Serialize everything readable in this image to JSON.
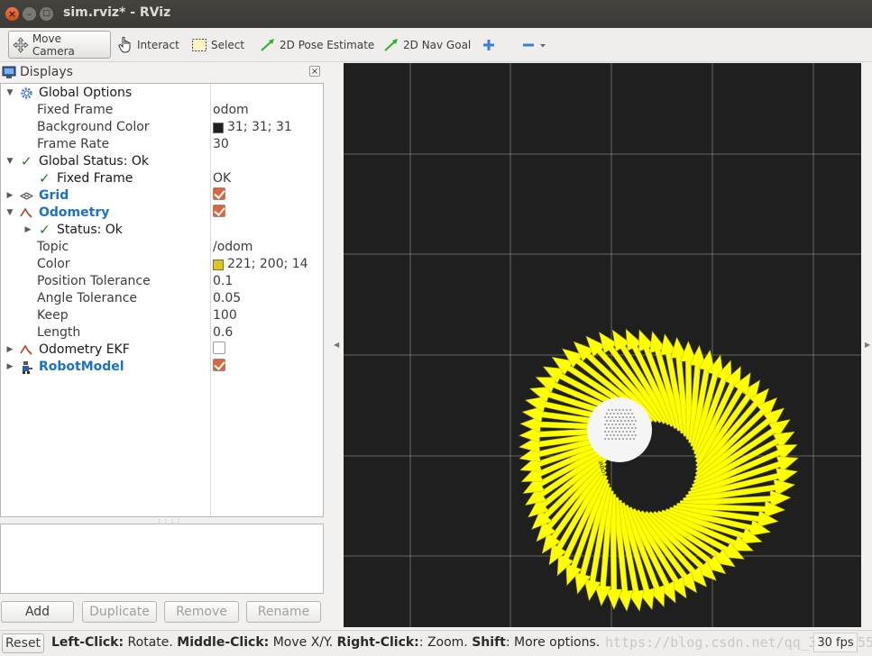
{
  "window": {
    "title": "sim.rviz* - RViz"
  },
  "toolbar": {
    "move_camera": "Move Camera",
    "interact": "Interact",
    "select": "Select",
    "pose_estimate": "2D Pose Estimate",
    "nav_goal": "2D Nav Goal"
  },
  "displays": {
    "title": "Displays",
    "global_options": {
      "label": "Global Options",
      "fixed_frame": {
        "label": "Fixed Frame",
        "value": "odom"
      },
      "background_color": {
        "label": "Background Color",
        "value": "31; 31; 31",
        "swatch": "#1f1f1f"
      },
      "frame_rate": {
        "label": "Frame Rate",
        "value": "30"
      }
    },
    "global_status": {
      "label": "Global Status: Ok",
      "fixed_frame": {
        "label": "Fixed Frame",
        "value": "OK"
      }
    },
    "grid": {
      "label": "Grid",
      "enabled": true
    },
    "odometry": {
      "label": "Odometry",
      "enabled": true,
      "status": "Status: Ok",
      "topic": {
        "label": "Topic",
        "value": "/odom"
      },
      "color": {
        "label": "Color",
        "value": "221; 200; 14",
        "swatch": "#ddc80e"
      },
      "position_tolerance": {
        "label": "Position Tolerance",
        "value": "0.1"
      },
      "angle_tolerance": {
        "label": "Angle Tolerance",
        "value": "0.05"
      },
      "keep": {
        "label": "Keep",
        "value": "100"
      },
      "length": {
        "label": "Length",
        "value": "0.6"
      }
    },
    "odometry_ekf": {
      "label": "Odometry EKF",
      "enabled": false
    },
    "robot_model": {
      "label": "RobotModel",
      "enabled": true
    }
  },
  "panel_buttons": {
    "add": "Add",
    "duplicate": "Duplicate",
    "remove": "Remove",
    "rename": "Rename"
  },
  "statusbar": {
    "reset": "Reset",
    "left_click": "Left-Click:",
    "left_click_action": " Rotate. ",
    "middle_click": "Middle-Click:",
    "middle_click_action": " Move X/Y. ",
    "right_click": "Right-Click:",
    "right_click_action": ": Zoom. ",
    "shift": "Shift",
    "shift_action": ": More options.",
    "watermark": "https://blog.csdn.net/qq_35750255",
    "fps": "30 fps"
  },
  "colors": {
    "arrow": "#ffff00",
    "grid": "#a0a0a0",
    "background": "#1f1f1f"
  }
}
